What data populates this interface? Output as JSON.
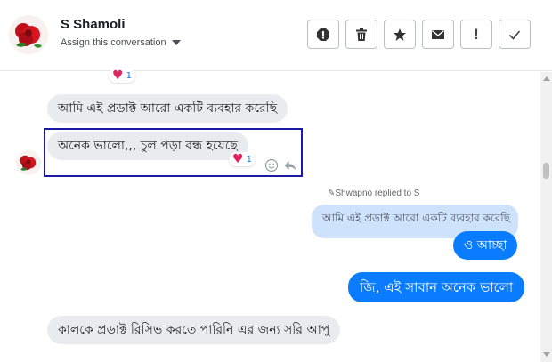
{
  "contact": {
    "name": "S Shamoli",
    "assign_label": "Assign this conversation"
  },
  "toolbar": {
    "spam_label": "!",
    "icons": [
      "alert-octagon-icon",
      "trash-icon",
      "star-icon",
      "envelope-icon",
      "exclamation-icon",
      "checkmark-icon"
    ]
  },
  "messages": {
    "m1": "আমি এই প্রডাক্ট আরো একটি ব্যবহার করেছি",
    "m2": "অনেক ভালো,,, চুল পড়া বন্ধ হয়েছে",
    "reply_note": "Shwapno replied to S",
    "quoted": "আমি এই প্রডাক্ট আরো একটি ব্যবহার করেছি",
    "m3": "ও আচ্ছা",
    "m4": "জি, এই সাবান অনেক ভালো",
    "m5": "কালকে প্রডাক্ট রিসিভ করতে পারিনি এর জন্য সরি আপু"
  },
  "reactions": {
    "top_count": "1",
    "m2_count": "1"
  },
  "colors": {
    "outgoing": "#0a7cff",
    "incoming": "#e9ebee",
    "quote": "#cfe2fb",
    "highlight": "#1a1aa6",
    "heart": "#e0245e"
  }
}
